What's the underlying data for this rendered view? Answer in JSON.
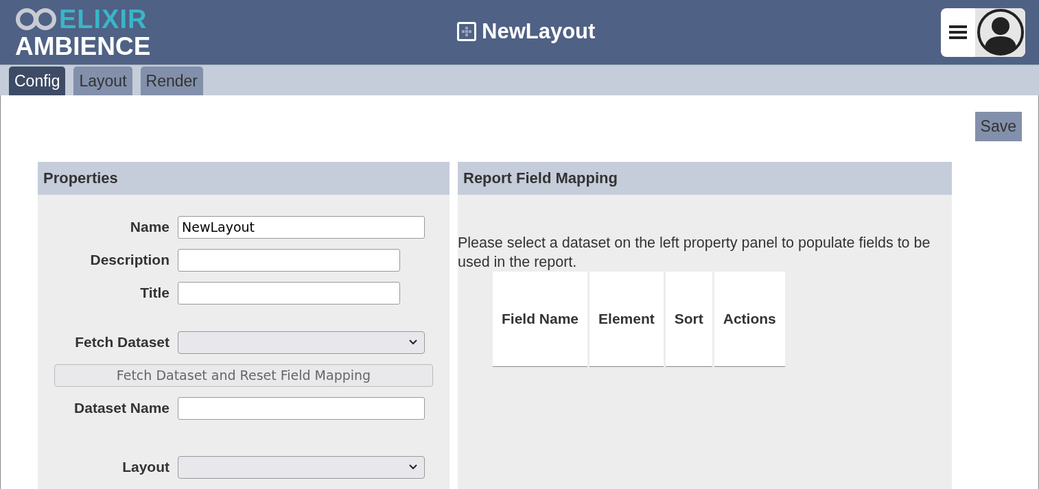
{
  "header": {
    "logo": {
      "top": "ELIXIR",
      "bottom": "AMBIENCE"
    },
    "title": "NewLayout"
  },
  "tabs": [
    {
      "label": "Config",
      "selected": true
    },
    {
      "label": "Layout",
      "selected": false
    },
    {
      "label": "Render",
      "selected": false
    }
  ],
  "save_button": "Save",
  "properties": {
    "title": "Properties",
    "rows": [
      {
        "kind": "input",
        "label": "Name",
        "value": "NewLayout"
      },
      {
        "kind": "input",
        "label": "Description",
        "value": ""
      },
      {
        "kind": "input",
        "label": "Title",
        "value": ""
      },
      {
        "kind": "select",
        "label": "Fetch Dataset"
      },
      {
        "kind": "button",
        "label": "Fetch Dataset and Reset Field Mapping",
        "disabled": true
      },
      {
        "kind": "input",
        "label": "Dataset Name",
        "value": ""
      },
      {
        "kind": "select",
        "label": "Layout"
      }
    ]
  },
  "mapping": {
    "title": "Report Field Mapping",
    "message": "Please select a dataset on the left property panel to populate fields to be used in the report.",
    "columns": [
      "Field Name",
      "Element",
      "Sort",
      "Actions"
    ]
  }
}
